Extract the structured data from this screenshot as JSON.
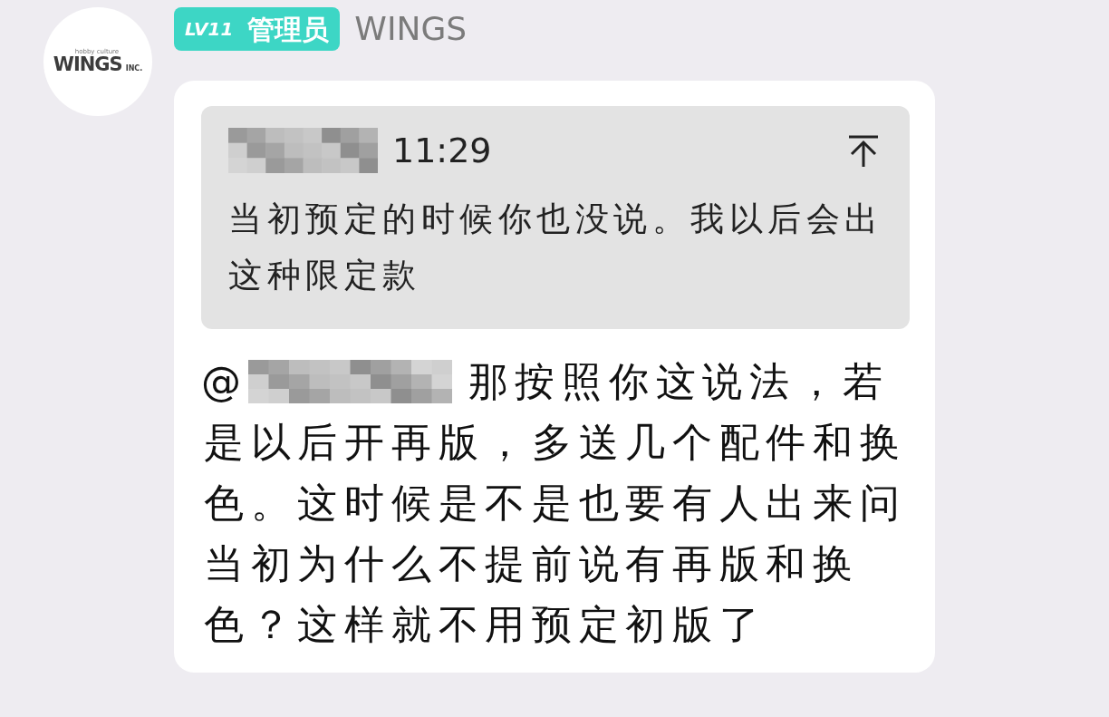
{
  "avatar": {
    "tagline": "hobby culture",
    "brand": "WINGS",
    "suffix": "INC."
  },
  "badge": {
    "level": "LV11",
    "role": "管理员"
  },
  "sender": "WINGS",
  "quote": {
    "time": "11:29",
    "text": "当初预定的时候你也没说。我以后会出这种限定款"
  },
  "message": {
    "mention_sign": "@",
    "first_line": "那按照你这说法，若",
    "rest": "是以后开再版，多送几个配件和换色。这时候是不是也要有人出来问当初为什么不提前说有再版和换色？这样就不用预定初版了"
  }
}
